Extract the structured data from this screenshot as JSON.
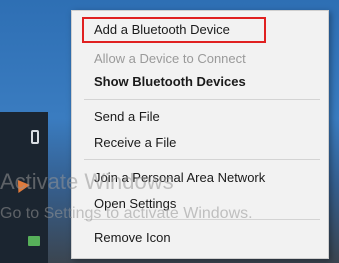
{
  "menu": {
    "items": [
      {
        "label": "Add a Bluetooth Device",
        "enabled": true,
        "bold": false,
        "highlighted": true
      },
      {
        "label": "Allow a Device to Connect",
        "enabled": false,
        "bold": false
      },
      {
        "label": "Show Bluetooth Devices",
        "enabled": true,
        "bold": true
      },
      {
        "label": "Send a File",
        "enabled": true,
        "bold": false
      },
      {
        "label": "Receive a File",
        "enabled": true,
        "bold": false
      },
      {
        "label": "Join a Personal Area Network",
        "enabled": true,
        "bold": false
      },
      {
        "label": "Open Settings",
        "enabled": true,
        "bold": false
      },
      {
        "label": "Remove Icon",
        "enabled": true,
        "bold": false
      }
    ]
  },
  "watermark": {
    "line1": "Activate Windows",
    "line2": "Go to Settings to activate Windows."
  },
  "taskbar": {
    "icons": [
      "phone-icon",
      "arrow-icon",
      "network-icon"
    ]
  },
  "colors": {
    "highlight_border": "#e02020",
    "menu_bg": "#f2f2f2",
    "disabled_text": "#9a9a9a"
  }
}
